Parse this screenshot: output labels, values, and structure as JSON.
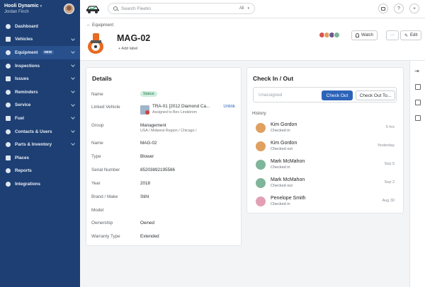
{
  "sidebar": {
    "org": "Hooli Dynamic",
    "user": "Jordan Finch",
    "items": [
      {
        "label": "Dashboard",
        "icon": "dashboard-icon",
        "chevron": false
      },
      {
        "label": "Vehicles",
        "icon": "car-icon",
        "chevron": true
      },
      {
        "label": "Equipment",
        "icon": "toolbox-icon",
        "chevron": true,
        "badge": "NEW",
        "active": true
      },
      {
        "label": "Inspections",
        "icon": "clipboard-icon",
        "chevron": true
      },
      {
        "label": "Issues",
        "icon": "alert-icon",
        "chevron": true
      },
      {
        "label": "Reminders",
        "icon": "bell-icon",
        "chevron": true
      },
      {
        "label": "Service",
        "icon": "wrench-icon",
        "chevron": true
      },
      {
        "label": "Fuel",
        "icon": "fuel-icon",
        "chevron": true
      },
      {
        "label": "Contacts & Users",
        "icon": "users-icon",
        "chevron": true
      },
      {
        "label": "Parts & Inventory",
        "icon": "box-icon",
        "chevron": true
      },
      {
        "label": "Places",
        "icon": "pin-icon",
        "chevron": false
      },
      {
        "label": "Reports",
        "icon": "chart-icon",
        "chevron": false
      },
      {
        "label": "Integrations",
        "icon": "puzzle-icon",
        "chevron": false
      }
    ]
  },
  "topbar": {
    "search_placeholder": "Search Fleetio",
    "search_scope": "All",
    "help_glyph": "?",
    "add_glyph": "+"
  },
  "header": {
    "breadcrumb": "← Equipment",
    "asset_name": "MAG-02",
    "add_label": "+ Add label",
    "watch_label": "Watch",
    "more_label": "···",
    "edit_label": "Edit"
  },
  "details": {
    "title": "Details",
    "rows": [
      {
        "label": "Name",
        "value": "Status",
        "kind": "status"
      },
      {
        "label": "Linked Vehicle",
        "value": "TRA-01 [2012 Diamond Ca...",
        "sub": "Assigned to Bev Lindstrom",
        "action": "Unlink",
        "kind": "vehicle"
      },
      {
        "label": "Group",
        "value": "Management",
        "sub": "USA / Midwest Region / Chicago /",
        "kind": "group"
      },
      {
        "label": "Name",
        "value": "MAG-02"
      },
      {
        "label": "Type",
        "value": "Blower"
      },
      {
        "label": "Serial Number",
        "value": "85203892195586"
      },
      {
        "label": "Year",
        "value": "2018"
      },
      {
        "label": "Brand / Make",
        "value": "Stihl"
      },
      {
        "label": "Model",
        "value": ""
      },
      {
        "label": "Ownership",
        "value": "Owned"
      },
      {
        "label": "Warranty Type",
        "value": "Extended"
      }
    ]
  },
  "checkinout": {
    "title": "Check In / Out",
    "unassigned": "Unassigned",
    "check_out": "Check Out",
    "check_out_to": "Check Out To...",
    "history_title": "History",
    "history": [
      {
        "name": "Kim Gordon",
        "status": "Checked in",
        "time": "5 hrs",
        "avatar_color": "#e0a060"
      },
      {
        "name": "Kim Gordon",
        "status": "Checked out",
        "time": "Yesterday",
        "avatar_color": "#e0a060"
      },
      {
        "name": "Mark McMahon",
        "status": "Checked in",
        "time": "Sep 5",
        "avatar_color": "#7fb59a"
      },
      {
        "name": "Mark McMahon",
        "status": "Checked out",
        "time": "Sep 2",
        "avatar_color": "#7fb59a"
      },
      {
        "name": "Penelope Smith",
        "status": "Checked in",
        "time": "Aug 30",
        "avatar_color": "#e3a0b5"
      }
    ]
  },
  "colors": {
    "sidebar_bg": "#1d3f73",
    "primary": "#2d63b8",
    "status_bg": "#cfeedd"
  }
}
